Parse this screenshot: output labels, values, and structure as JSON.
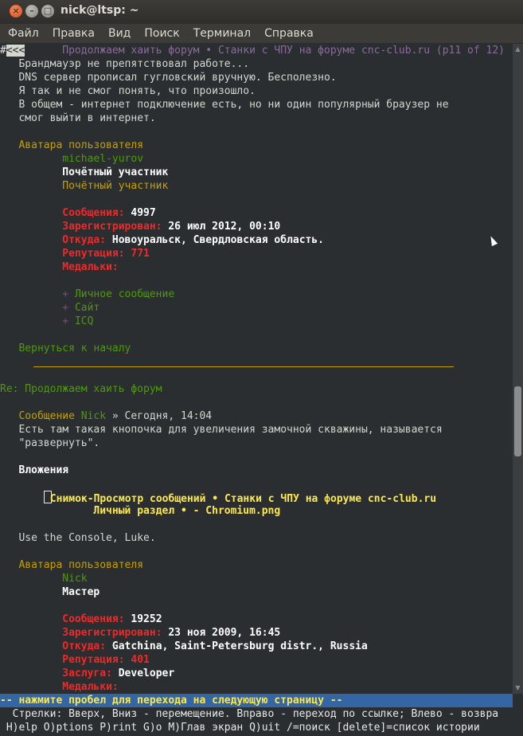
{
  "window": {
    "title": "nick@ltsp: ~",
    "close_glyph": "×",
    "min_glyph": "–",
    "max_glyph": "□"
  },
  "menu": [
    "Файл",
    "Правка",
    "Вид",
    "Поиск",
    "Терминал",
    "Справка"
  ],
  "terminal": {
    "top": {
      "back": "<<<",
      "title": "Продолжаем хаить форум • Станки с ЧПУ на форуме cnc-club.ru (p11 of 12)"
    },
    "para1": [
      "Брандмауэр не препятствовал работе...",
      "DNS сервер прописал гугловский вручную. Бесполезно.",
      "Я так и не смог понять, что произошло.",
      "В общем - интернет подключение есть, но ни один популярный браузер не",
      "смог выйти в интернет."
    ],
    "post1": {
      "avatar": "Аватара пользователя",
      "user": "michael-yurov",
      "rank_bold": "Почётный участник",
      "rank_link": "Почётный участник",
      "messages_label": "Сообщения:",
      "messages": "4997",
      "registered_label": "Зарегистрирован:",
      "registered": "26 июл 2012, 00:10",
      "from_label": "Откуда:",
      "from": "Новоуральск, Свердловская область.",
      "rep_label": "Репутация:",
      "rep": "771",
      "medals_label": "Медальки:",
      "plus": "+",
      "links": [
        "Личное сообщение",
        "Сайт",
        "ICQ"
      ],
      "back_to_top": "Вернуться к началу"
    },
    "post2": {
      "re_title": "Re: Продолжаем хаить форум",
      "msg_label": "Сообщение",
      "author": "Nick",
      "date": "» Сегодня, 14:04",
      "body1": "Есть там такая кнопочка для увеличения замочной скважины, называется",
      "body2": "\"развернуть\".",
      "attachments": "Вложения",
      "attach_line1": "Снимок-Просмотр сообщений • Станки с ЧПУ на форуме cnc-club.ru",
      "attach_line2": "Личный раздел • - Chromium.png",
      "quote": "Use the Console, Luke.",
      "avatar": "Аватара пользователя",
      "user": "Nick",
      "rank": "Мастер",
      "messages_label": "Сообщения:",
      "messages": "19252",
      "registered_label": "Зарегистрирован:",
      "registered": "23 ноя 2009, 16:45",
      "from_label": "Откуда:",
      "from": "Gatchina, Saint-Petersburg distr., Russia",
      "rep_label": "Репутация:",
      "rep": "401",
      "merit_label": "Заслуга:",
      "merit": "Developer",
      "medals_label": "Медальки:"
    },
    "status": "-- нажмите пробел для перехода на следующую страницу --",
    "help1": "  Стрелки: Вверх, Вниз - перемещение. Вправо - переход по ссылке; Влево - возвра",
    "help2": " H)elp O)ptions P)rint G)o M)Глав экран Q)uit /=поиск [delete]=список истории"
  }
}
